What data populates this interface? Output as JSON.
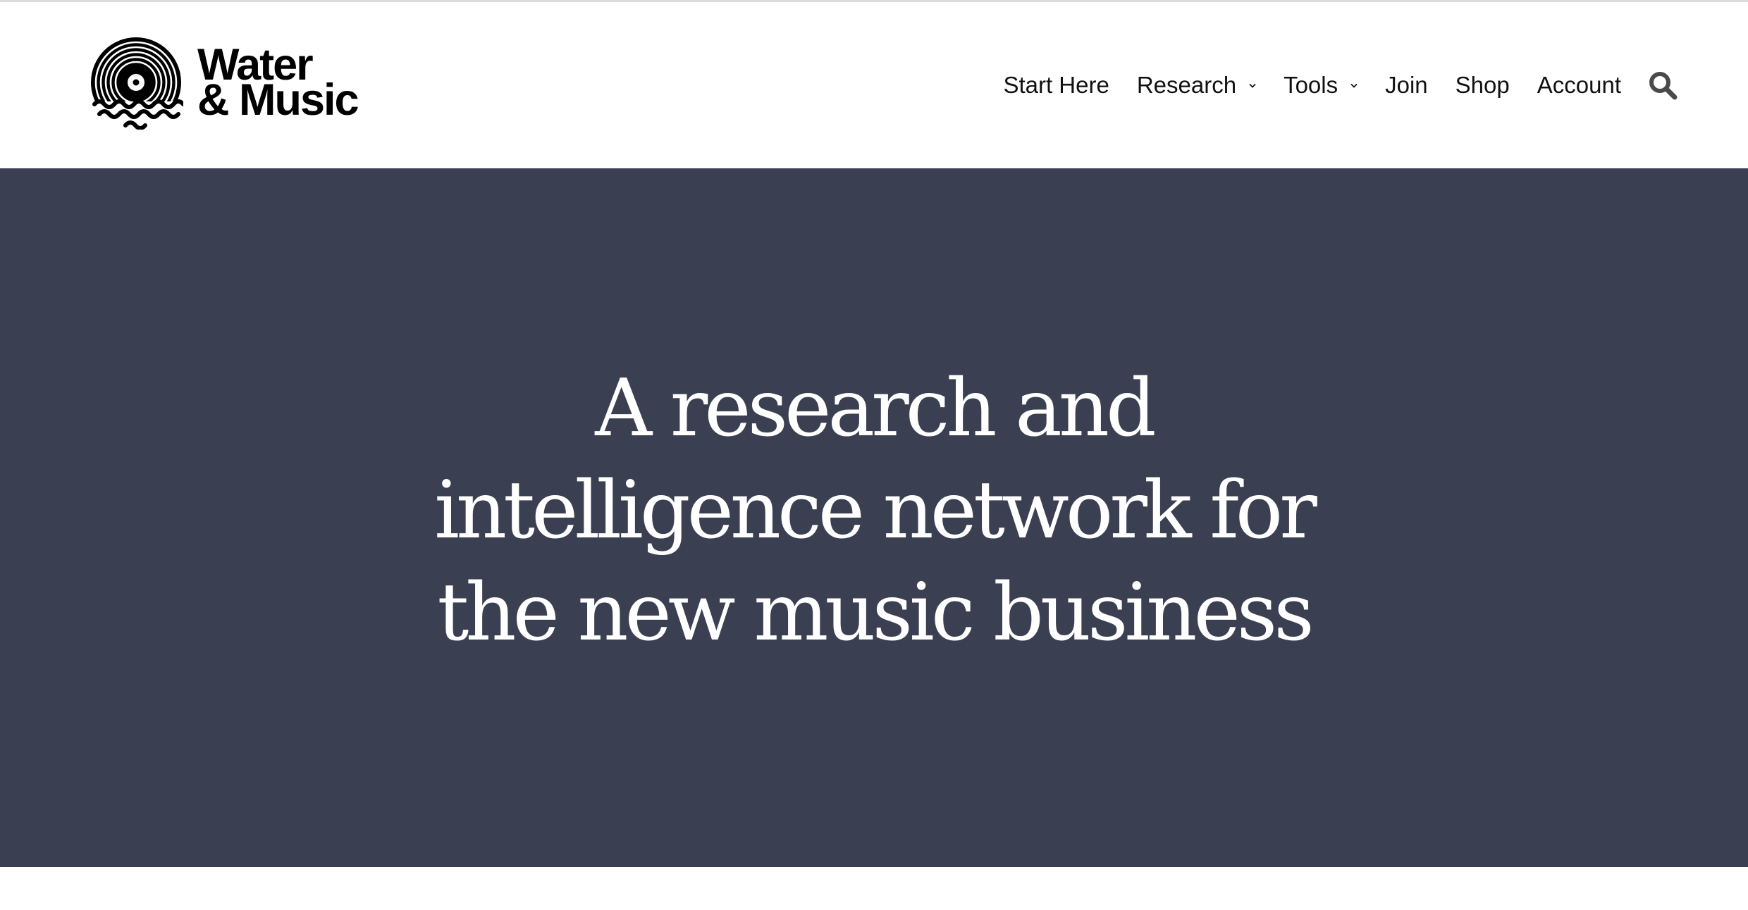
{
  "brand": {
    "line1": "Water",
    "line2": "& Music",
    "logo_icon": "vinyl-record-waves-icon"
  },
  "nav": {
    "items": [
      {
        "label": "Start Here",
        "has_dropdown": false
      },
      {
        "label": "Research",
        "has_dropdown": true
      },
      {
        "label": "Tools",
        "has_dropdown": true
      },
      {
        "label": "Join",
        "has_dropdown": false
      },
      {
        "label": "Shop",
        "has_dropdown": false
      },
      {
        "label": "Account",
        "has_dropdown": false
      }
    ],
    "search_icon": "search-icon"
  },
  "hero": {
    "title": "A research and intelligence network for the new music business"
  },
  "colors": {
    "hero_background": "#3a3f52",
    "hero_text": "#ffffff",
    "nav_text": "#111111",
    "page_background": "#ffffff"
  }
}
